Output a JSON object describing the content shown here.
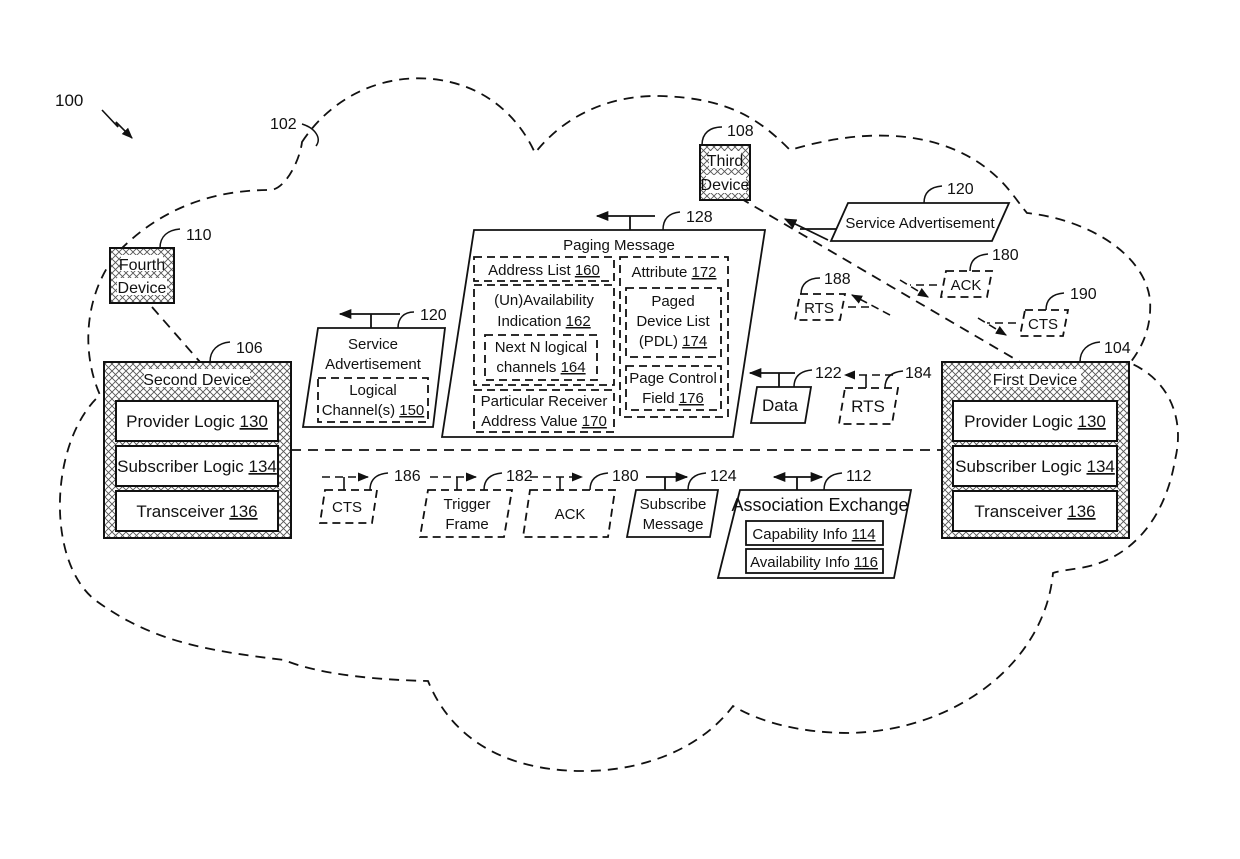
{
  "figure": {
    "ref": "100",
    "network_ref": "102"
  },
  "devices": {
    "first": {
      "ref": "104",
      "title": "First Device",
      "modules": [
        {
          "label": "Provider Logic",
          "num": "130"
        },
        {
          "label": "Subscriber Logic",
          "num": "134"
        },
        {
          "label": "Transceiver",
          "num": "136"
        }
      ]
    },
    "second": {
      "ref": "106",
      "title": "Second Device",
      "modules": [
        {
          "label": "Provider Logic",
          "num": "130"
        },
        {
          "label": "Subscriber Logic",
          "num": "134"
        },
        {
          "label": "Transceiver",
          "num": "136"
        }
      ]
    },
    "third": {
      "ref": "108",
      "line1": "Third",
      "line2": "Device"
    },
    "fourth": {
      "ref": "110",
      "line1": "Fourth",
      "line2": "Device"
    }
  },
  "paging_message": {
    "ref": "128",
    "title": "Paging Message",
    "address_list": {
      "label": "Address List",
      "num": "160"
    },
    "unavailability": {
      "line1": "(Un)Availability",
      "line2": "Indication",
      "num": "162"
    },
    "next_n": {
      "line1": "Next N logical",
      "line2": "channels",
      "num": "164"
    },
    "receiver_address": {
      "line1": "Particular Receiver",
      "line2": "Address Value",
      "num": "170"
    },
    "attribute": {
      "label": "Attribute",
      "num": "172"
    },
    "pdl": {
      "line1": "Paged",
      "line2": "Device List",
      "line3": "(PDL)",
      "num": "174"
    },
    "page_control": {
      "line1": "Page Control",
      "line2": "Field",
      "num": "176"
    }
  },
  "service_ad_left": {
    "ref": "120",
    "line1": "Service",
    "line2": "Advertisement",
    "channel_line1": "Logical",
    "channel_line2": "Channel(s)",
    "channel_num": "150"
  },
  "service_ad_right": {
    "ref": "120",
    "label": "Service Advertisement"
  },
  "messages": {
    "data": {
      "ref": "122",
      "label": "Data"
    },
    "rts_184": {
      "ref": "184",
      "label": "RTS"
    },
    "rts_188": {
      "ref": "188",
      "label": "RTS"
    },
    "ack_180_top": {
      "ref": "180",
      "label": "ACK"
    },
    "cts_190": {
      "ref": "190",
      "label": "CTS"
    },
    "cts_186": {
      "ref": "186",
      "label": "CTS"
    },
    "trigger_182": {
      "ref": "182",
      "line1": "Trigger",
      "line2": "Frame"
    },
    "ack_180_bottom": {
      "ref": "180",
      "label": "ACK"
    },
    "subscribe_124": {
      "ref": "124",
      "line1": "Subscribe",
      "line2": "Message"
    }
  },
  "association": {
    "ref": "112",
    "title": "Association Exchange",
    "capability": {
      "label": "Capability Info",
      "num": "114"
    },
    "availability": {
      "label": "Availability Info",
      "num": "116"
    }
  }
}
